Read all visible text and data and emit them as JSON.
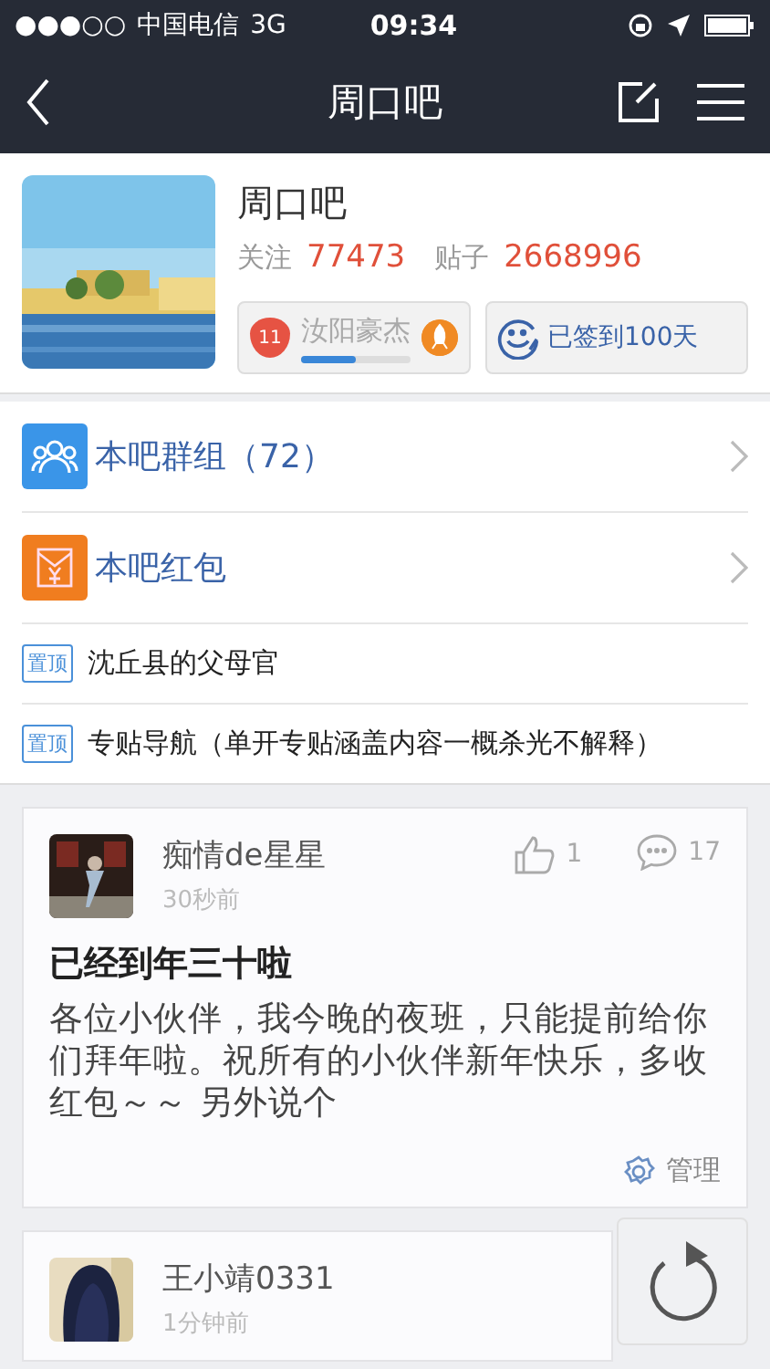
{
  "status_bar": {
    "signal": "●●●○○",
    "carrier": "中国电信",
    "network": "3G",
    "time": "09:34"
  },
  "nav_bar": {
    "title": "周口吧"
  },
  "forum": {
    "name": "周口吧",
    "follow_label": "关注",
    "follow_count": "77473",
    "posts_label": "贴子",
    "posts_count": "2668996",
    "level_badge": {
      "level_number": "11",
      "title": "汝阳豪杰",
      "level": 0.5
    },
    "sign_in": {
      "label": "已签到100天"
    }
  },
  "entries": [
    {
      "kind": "group",
      "label": "本吧群组（72）"
    },
    {
      "kind": "redpacket",
      "label": "本吧红包"
    }
  ],
  "pinned": [
    {
      "tag": "置顶",
      "title": "沈丘县的父母官"
    },
    {
      "tag": "置顶",
      "title": "专贴导航（单开专贴涵盖内容一概杀光不解释）"
    }
  ],
  "posts": [
    {
      "author": "痴情de星星",
      "time": "30秒前",
      "likes": "1",
      "comments": "17",
      "title": "已经到年三十啦",
      "body": "各位小伙伴，我今晚的夜班，只能提前给你们拜年啦。祝所有的小伙伴新年快乐，多收红包～～ 另外说个",
      "manage": "管理"
    },
    {
      "author": "王小靖0331",
      "time": "1分钟前"
    }
  ]
}
